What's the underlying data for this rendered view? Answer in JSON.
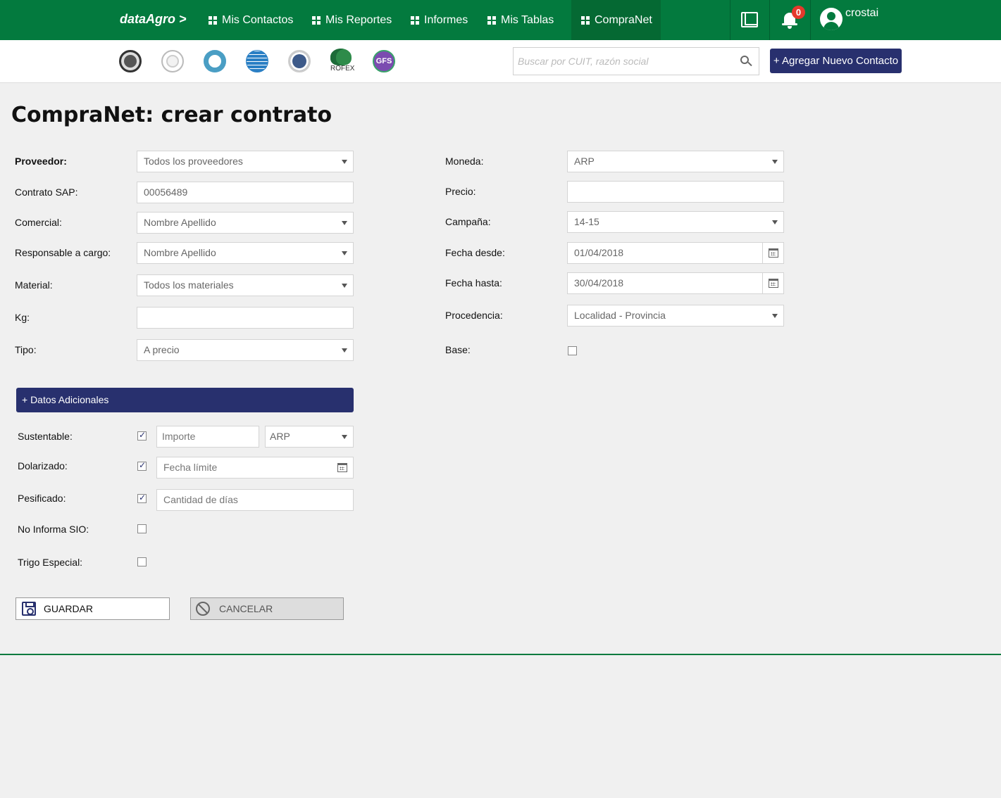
{
  "nav": {
    "brand": "dataAgro >",
    "items": [
      "Mis Contactos",
      "Mis Reportes",
      "Informes",
      "Mis Tablas",
      "CompraNet"
    ],
    "notifications": "0",
    "user": "crostai"
  },
  "subbar": {
    "logos": [
      "bolsa-cereales-logo",
      "ministerio-logo",
      "notes-logo",
      "globe-logo",
      "matba-logo",
      "rofex-logo",
      "gfs-logo"
    ],
    "rofex_label": "ROFEX",
    "gfs_label": "GFS",
    "search_placeholder": "Buscar por CUIT, razón social",
    "add_contact": "+ Agregar Nuevo Contacto"
  },
  "page": {
    "title": "CompraNet: crear contrato"
  },
  "form_left": {
    "proveedor": {
      "label": "Proveedor:",
      "value": "Todos los proveedores"
    },
    "contrato_sap": {
      "label": "Contrato SAP:",
      "value": "00056489"
    },
    "comercial": {
      "label": "Comercial:",
      "value": "Nombre Apellido"
    },
    "responsable": {
      "label": "Responsable a cargo:",
      "value": "Nombre Apellido"
    },
    "material": {
      "label": "Material:",
      "value": "Todos los materiales"
    },
    "kg": {
      "label": "Kg:",
      "value": ""
    },
    "tipo": {
      "label": "Tipo:",
      "value": "A precio"
    }
  },
  "form_right": {
    "moneda": {
      "label": "Moneda:",
      "value": "ARP"
    },
    "precio": {
      "label": "Precio:",
      "value": ""
    },
    "campana": {
      "label": "Campaña:",
      "value": "14-15"
    },
    "fecha_desde": {
      "label": "Fecha desde:",
      "value": "01/04/2018"
    },
    "fecha_hasta": {
      "label": "Fecha hasta:",
      "value": "30/04/2018"
    },
    "procedencia": {
      "label": "Procedencia:",
      "value": "Localidad - Provincia"
    },
    "base": {
      "label": "Base:",
      "checked": false
    }
  },
  "datos_adicionales": {
    "toggle": "+ Datos Adicionales",
    "sustentable": {
      "label": "Sustentable:",
      "checked": true,
      "importe_placeholder": "Importe",
      "currency": "ARP"
    },
    "dolarizado": {
      "label": "Dolarizado:",
      "checked": true,
      "placeholder": "Fecha límite"
    },
    "pesificado": {
      "label": "Pesificado:",
      "checked": true,
      "placeholder": "Cantidad de días"
    },
    "no_informa_sio": {
      "label": "No Informa SIO:",
      "checked": false
    },
    "trigo_especial": {
      "label": "Trigo Especial:",
      "checked": false
    }
  },
  "actions": {
    "save": "GUARDAR",
    "cancel": "CANCELAR"
  },
  "colors": {
    "primary_green": "#037a3e",
    "navy": "#28306e",
    "badge_red": "#e5392c"
  }
}
